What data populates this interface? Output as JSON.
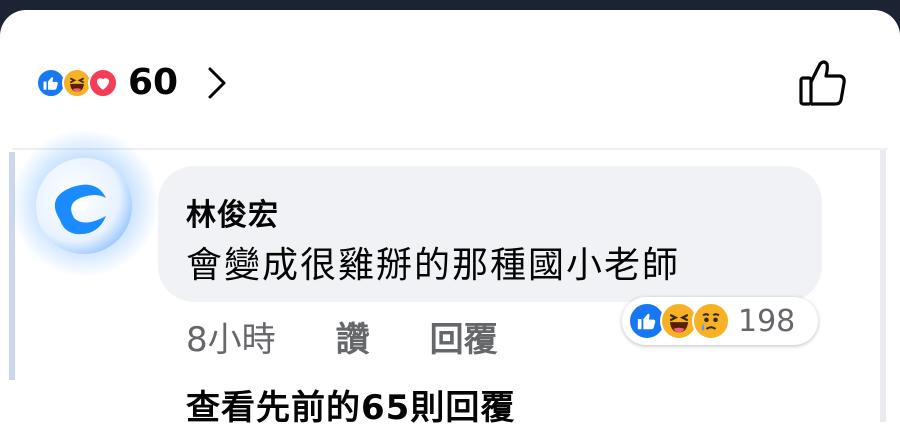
{
  "reactions_bar": {
    "icons": [
      "like-icon",
      "haha-icon",
      "love-icon"
    ],
    "count": "60",
    "chevron_icon": "chevron-right-icon",
    "like_button_icon": "thumbs-up-outline-icon"
  },
  "comment": {
    "author": "林俊宏",
    "text": "會變成很雞掰的那種國小老師",
    "time": "8小時",
    "like_label": "讚",
    "reply_label": "回覆",
    "reactions": {
      "icons": [
        "like-icon",
        "haha-icon",
        "sad-icon"
      ],
      "count": "198"
    }
  },
  "view_more_replies": "查看先前的65則回覆",
  "colors": {
    "like_blue": "#1877f2",
    "haha_yellow": "#f7b125",
    "love_red": "#f33e58",
    "bubble_bg": "#f0f2f5",
    "muted_text": "#65676b"
  }
}
